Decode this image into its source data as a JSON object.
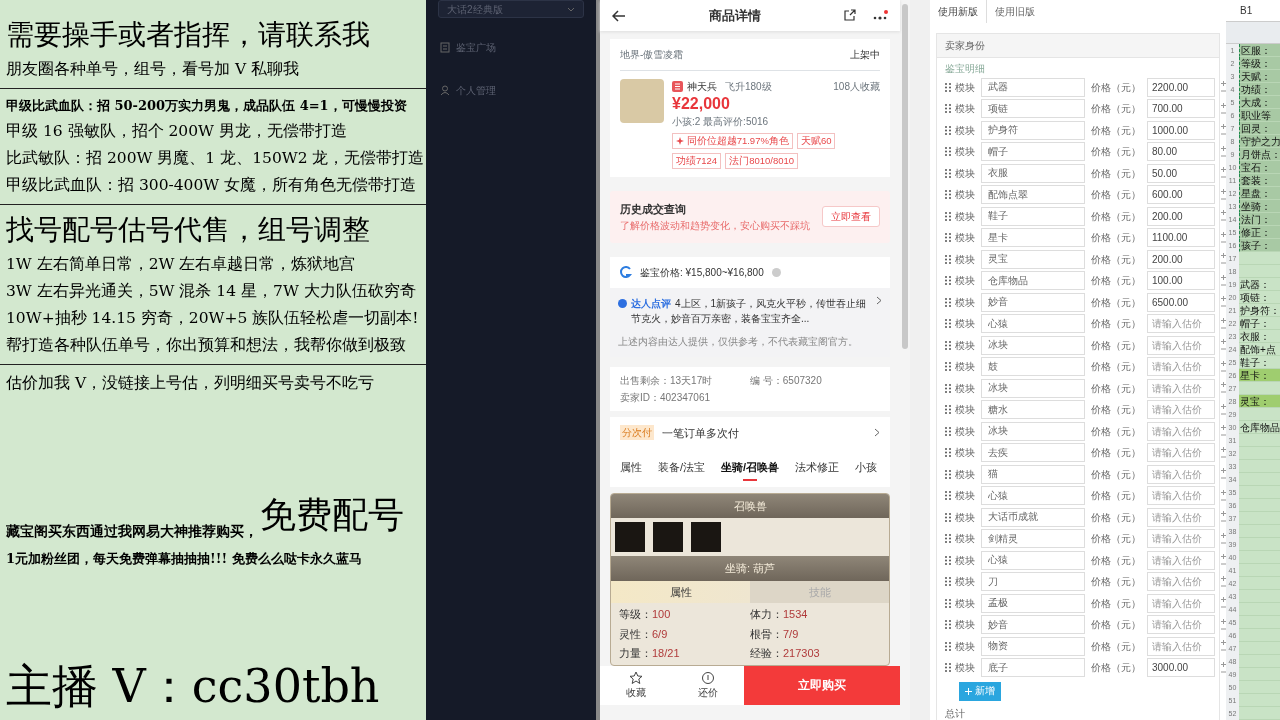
{
  "promo": {
    "lines": [
      {
        "kind": "title",
        "text": "需要操手或者指挥，请联系我"
      },
      {
        "kind": "body",
        "text": "朋友圈各种单号，组号，看号加 V 私聊我"
      },
      {
        "kind": "divider"
      },
      {
        "kind": "small",
        "text": "甲级比武血队：招 50-200万实力男鬼，成品队伍 4=1，可慢慢投资"
      },
      {
        "kind": "body",
        "text": "甲级 16 强敏队，招个 200W 男龙，无偿带打造"
      },
      {
        "kind": "body",
        "text": "比武敏队：招 200W 男魔、1 龙、150W2 龙，无偿带打造"
      },
      {
        "kind": "body",
        "text": "甲级比武血队：招 300-400W 女魔，所有角色无偿带打造"
      },
      {
        "kind": "divider"
      },
      {
        "kind": "title",
        "text": "找号配号估号代售，组号调整"
      },
      {
        "kind": "body",
        "text": "1W 左右简单日常，2W 左右卓越日常，炼狱地宫"
      },
      {
        "kind": "body",
        "text": "3W 左右异光通关，5W 混杀 14 星，7W 大力队伍砍穷奇"
      },
      {
        "kind": "body",
        "text": "10W+抽秒 14.15 穷奇，20W+5 族队伍轻松虐一切副本!"
      },
      {
        "kind": "body",
        "text": "帮打造各种队伍单号，你出预算和想法，我帮你做到极致"
      },
      {
        "kind": "divider"
      },
      {
        "kind": "body",
        "text": "估价加我 V，没链接上号估，列明细买号卖号不吃亏"
      },
      {
        "kind": "split",
        "text": "藏宝阁买东西通过我网易大神推荐购买，",
        "accent": "免费配号"
      },
      {
        "kind": "small",
        "text": "1元加粉丝团，每天免费弹幕抽抽抽!!! 免费么么哒卡永久蓝马"
      },
      {
        "kind": "huge",
        "text": "主播 V：cc30tbh"
      }
    ]
  },
  "sidebar": {
    "version_select": "大话2经典版",
    "items": [
      "鉴宝广场",
      "个人管理"
    ]
  },
  "product_page": {
    "title": "商品详情",
    "server": "地界-傲雪凌霜",
    "status": "上架中",
    "role": {
      "name": "神天兵",
      "level": "飞升180级",
      "favorites": "108人收藏",
      "price": "¥22,000",
      "summary": "小孩:2 最高评价:5016",
      "tags": [
        "同价位超越71.97%角色",
        "天赋60",
        "功绩7124",
        "法门8010/8010"
      ]
    },
    "history": {
      "title": "历史成交查询",
      "subtitle": "了解价格波动和趋势变化，安心购买不踩坑",
      "button": "立即查看"
    },
    "appraisal": "鉴宝价格: ¥15,800~¥16,800",
    "review": {
      "label": "达人点评",
      "text": "4上区，1新孩子，风克火平秒，传世吞止细节克火，妙音百万亲密，装备宝宝齐全...",
      "note": "上述内容由达人提供，仅供参考，不代表藏宝阁官方。"
    },
    "meta": [
      {
        "label": "出售剩余：",
        "value": "13天17时"
      },
      {
        "label": "编 号：",
        "value": "6507320"
      },
      {
        "label": "卖家ID：",
        "value": "402347061"
      }
    ],
    "installment": {
      "tag": "分次付",
      "text": "一笔订单多次付"
    },
    "tabs": [
      {
        "label": "属性",
        "selected": false
      },
      {
        "label": "装备/法宝",
        "selected": false
      },
      {
        "label": "坐骑/召唤兽",
        "selected": true
      },
      {
        "label": "法术修正",
        "selected": false
      },
      {
        "label": "小孩",
        "selected": false
      }
    ],
    "pet_panel": {
      "title": "召唤兽",
      "mount_title": "坐骑: 葫芦",
      "subtabs": [
        {
          "label": "属性",
          "selected": true
        },
        {
          "label": "技能",
          "selected": false
        }
      ],
      "stats": [
        {
          "label": "等级：",
          "value": "100"
        },
        {
          "label": "体力：",
          "value": "1534"
        },
        {
          "label": "灵性：",
          "value": "6/9"
        },
        {
          "label": "根骨：",
          "value": "7/9"
        },
        {
          "label": "力量：",
          "value": "18/21"
        },
        {
          "label": "经验：",
          "value": "217303"
        }
      ]
    },
    "bottom_bar": {
      "actions": [
        "收藏",
        "还价"
      ],
      "buy": "立即购买"
    }
  },
  "appraisal_form": {
    "tabs": [
      {
        "label": "使用新版",
        "selected": true
      },
      {
        "label": "使用旧版",
        "selected": false
      }
    ],
    "section": "卖家身份",
    "subsection": "鉴宝明细",
    "rows": [
      {
        "handle": "模块",
        "name": "武器",
        "price_label": "价格（元）",
        "value": "2200.00"
      },
      {
        "handle": "模块",
        "name": "项链",
        "price_label": "价格（元）",
        "value": "700.00"
      },
      {
        "handle": "模块",
        "name": "护身符",
        "price_label": "价格（元）",
        "value": "1000.00"
      },
      {
        "handle": "模块",
        "name": "帽子",
        "price_label": "价格（元）",
        "value": "80.00"
      },
      {
        "handle": "模块",
        "name": "衣服",
        "price_label": "价格（元）",
        "value": "50.00"
      },
      {
        "handle": "模块",
        "name": "配饰点翠",
        "price_label": "价格（元）",
        "value": "600.00"
      },
      {
        "handle": "模块",
        "name": "鞋子",
        "price_label": "价格（元）",
        "value": "200.00"
      },
      {
        "handle": "模块",
        "name": "星卡",
        "price_label": "价格（元）",
        "value": "1100.00"
      },
      {
        "handle": "模块",
        "name": "灵宝",
        "price_label": "价格（元）",
        "value": "200.00"
      },
      {
        "handle": "模块",
        "name": "仓库物品",
        "price_label": "价格（元）",
        "value": "100.00"
      },
      {
        "handle": "模块",
        "name": "妙音",
        "price_label": "价格（元）",
        "value": "6500.00"
      },
      {
        "handle": "模块",
        "name": "心猿",
        "price_label": "价格（元）",
        "placeholder": "请输入估价"
      },
      {
        "handle": "模块",
        "name": "冰块",
        "price_label": "价格（元）",
        "placeholder": "请输入估价"
      },
      {
        "handle": "模块",
        "name": "鼓",
        "price_label": "价格（元）",
        "placeholder": "请输入估价"
      },
      {
        "handle": "模块",
        "name": "冰块",
        "price_label": "价格（元）",
        "placeholder": "请输入估价"
      },
      {
        "handle": "模块",
        "name": "糖水",
        "price_label": "价格（元）",
        "placeholder": "请输入估价"
      },
      {
        "handle": "模块",
        "name": "冰块",
        "price_label": "价格（元）",
        "placeholder": "请输入估价"
      },
      {
        "handle": "模块",
        "name": "去疾",
        "price_label": "价格（元）",
        "placeholder": "请输入估价"
      },
      {
        "handle": "模块",
        "name": "猫",
        "price_label": "价格（元）",
        "placeholder": "请输入估价"
      },
      {
        "handle": "模块",
        "name": "心猿",
        "price_label": "价格（元）",
        "placeholder": "请输入估价"
      },
      {
        "handle": "模块",
        "name": "大话币成就",
        "price_label": "价格（元）",
        "placeholder": "请输入估价"
      },
      {
        "handle": "模块",
        "name": "剑精灵",
        "price_label": "价格（元）",
        "placeholder": "请输入估价"
      },
      {
        "handle": "模块",
        "name": "心猿",
        "price_label": "价格（元）",
        "placeholder": "请输入估价"
      },
      {
        "handle": "模块",
        "name": "刀",
        "price_label": "价格（元）",
        "placeholder": "请输入估价"
      },
      {
        "handle": "模块",
        "name": "孟极",
        "price_label": "价格（元）",
        "placeholder": "请输入估价"
      },
      {
        "handle": "模块",
        "name": "妙音",
        "price_label": "价格（元）",
        "placeholder": "请输入估价"
      },
      {
        "handle": "模块",
        "name": "物资",
        "price_label": "价格（元）",
        "placeholder": "请输入估价"
      },
      {
        "handle": "模块",
        "name": "底子",
        "price_label": "价格（元）",
        "value": "3000.00"
      }
    ],
    "add_button": "新增",
    "total_label": "总计"
  },
  "spreadsheet": {
    "name_box": "B1",
    "rows": [
      {
        "number": "1",
        "text": "区服：",
        "selected": true,
        "highlighted": false
      },
      {
        "number": "2",
        "text": "等级：",
        "selected": true,
        "highlighted": false
      },
      {
        "number": "3",
        "text": "天赋：",
        "selected": true,
        "highlighted": false
      },
      {
        "number": "4",
        "text": "功绩：",
        "selected": true,
        "highlighted": false
      },
      {
        "number": "5",
        "text": "大成：",
        "selected": true,
        "highlighted": false
      },
      {
        "number": "6",
        "text": "职业等",
        "selected": true,
        "highlighted": false
      },
      {
        "number": "7",
        "text": "回灵：",
        "selected": true,
        "highlighted": false
      },
      {
        "number": "8",
        "text": "守护之力",
        "selected": true,
        "highlighted": false
      },
      {
        "number": "9",
        "text": "月饼点：",
        "selected": true,
        "highlighted": false
      },
      {
        "number": "10",
        "text": "宝石：",
        "selected": true,
        "highlighted": false
      },
      {
        "number": "11",
        "text": "套装：",
        "selected": true,
        "highlighted": false
      },
      {
        "number": "12",
        "text": "星盘：",
        "selected": true,
        "highlighted": false
      },
      {
        "number": "13",
        "text": "坐骑：",
        "selected": true,
        "highlighted": false
      },
      {
        "number": "14",
        "text": "法门：",
        "selected": true,
        "highlighted": false
      },
      {
        "number": "15",
        "text": "修正：",
        "selected": true,
        "highlighted": false
      },
      {
        "number": "16",
        "text": "孩子：",
        "selected": true,
        "highlighted": false
      },
      {
        "number": "17",
        "selected": false,
        "highlighted": false
      },
      {
        "number": "18",
        "selected": false,
        "highlighted": false
      },
      {
        "number": "19",
        "text": "武器：",
        "selected": false,
        "highlighted": false
      },
      {
        "number": "20",
        "text": "项链：",
        "selected": false,
        "highlighted": false
      },
      {
        "number": "21",
        "text": "护身符：",
        "selected": false,
        "highlighted": false
      },
      {
        "number": "22",
        "text": "帽子：",
        "selected": false,
        "highlighted": false
      },
      {
        "number": "23",
        "text": "衣服：",
        "selected": false,
        "highlighted": false
      },
      {
        "number": "24",
        "text": "配饰+点",
        "selected": false,
        "highlighted": false
      },
      {
        "number": "25",
        "text": "鞋子：",
        "selected": false,
        "highlighted": false
      },
      {
        "number": "26",
        "text": "星卡：",
        "selected": false,
        "highlighted": true
      },
      {
        "number": "27",
        "selected": false,
        "highlighted": false
      },
      {
        "number": "28",
        "text": "灵宝：",
        "selected": false,
        "highlighted": true
      },
      {
        "number": "29",
        "selected": false,
        "highlighted": false
      },
      {
        "number": "30",
        "text": "仓库物品",
        "selected": false,
        "highlighted": false
      },
      {
        "number": "31",
        "selected": false,
        "highlighted": false
      },
      {
        "number": "32",
        "selected": false,
        "highlighted": false
      },
      {
        "number": "33",
        "selected": false,
        "highlighted": false
      },
      {
        "number": "34",
        "selected": false,
        "highlighted": false
      },
      {
        "number": "35",
        "selected": false,
        "highlighted": false
      },
      {
        "number": "36",
        "selected": false,
        "highlighted": false
      },
      {
        "number": "37",
        "selected": false,
        "highlighted": false
      },
      {
        "number": "38",
        "selected": false,
        "highlighted": false
      },
      {
        "number": "39",
        "selected": false,
        "highlighted": false
      },
      {
        "number": "40",
        "selected": false,
        "highlighted": false
      },
      {
        "number": "41",
        "selected": false,
        "highlighted": false
      },
      {
        "number": "42",
        "selected": false,
        "highlighted": false
      },
      {
        "number": "43",
        "selected": false,
        "highlighted": false
      },
      {
        "number": "44",
        "selected": false,
        "highlighted": false
      },
      {
        "number": "45",
        "selected": false,
        "highlighted": false
      },
      {
        "number": "46",
        "selected": false,
        "highlighted": false
      },
      {
        "number": "47",
        "selected": false,
        "highlighted": false
      },
      {
        "number": "48",
        "selected": false,
        "highlighted": false
      },
      {
        "number": "49",
        "selected": false,
        "highlighted": false
      },
      {
        "number": "50",
        "selected": false,
        "highlighted": false
      },
      {
        "number": "51",
        "selected": false,
        "highlighted": false
      },
      {
        "number": "52",
        "selected": false,
        "highlighted": false
      }
    ]
  }
}
